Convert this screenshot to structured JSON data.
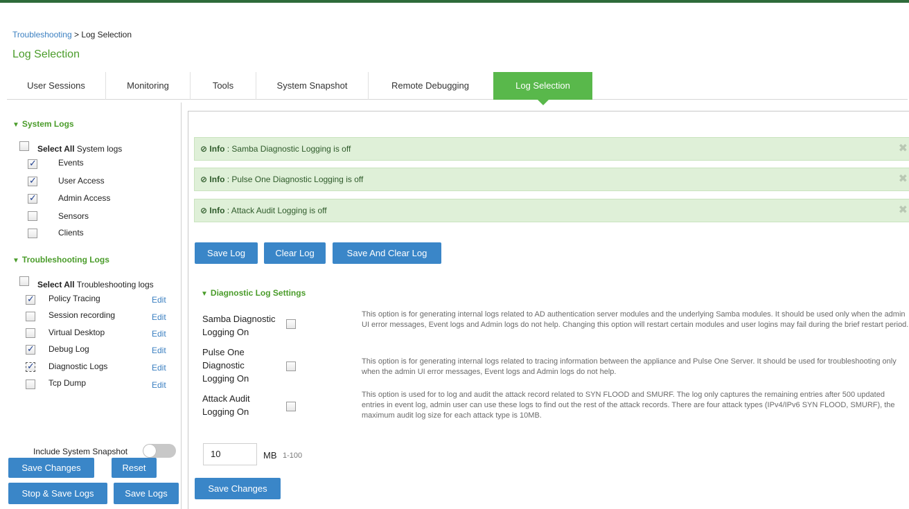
{
  "breadcrumb": {
    "link": "Troubleshooting",
    "separator": " > ",
    "current": "Log Selection"
  },
  "page_title": "Log Selection",
  "tabs": [
    {
      "label": "User Sessions"
    },
    {
      "label": "Monitoring"
    },
    {
      "label": "Tools"
    },
    {
      "label": "System Snapshot"
    },
    {
      "label": "Remote Debugging"
    },
    {
      "label": "Log Selection",
      "active": true
    }
  ],
  "system_logs": {
    "title": "System Logs",
    "select_all_bold": "Select All",
    "select_all_rest": " System logs",
    "items": [
      {
        "label": "Events",
        "checked": true
      },
      {
        "label": "User Access",
        "checked": true
      },
      {
        "label": "Admin Access",
        "checked": true
      },
      {
        "label": "Sensors",
        "checked": false
      },
      {
        "label": "Clients",
        "checked": false
      }
    ]
  },
  "troubleshooting_logs": {
    "title": "Troubleshooting Logs",
    "select_all_bold": "Select All",
    "select_all_rest": " Troubleshooting logs",
    "edit_label": "Edit",
    "items": [
      {
        "label": "Policy Tracing",
        "checked": true
      },
      {
        "label": "Session recording",
        "checked": false
      },
      {
        "label": "Virtual Desktop",
        "checked": false
      },
      {
        "label": "Debug Log",
        "checked": true
      },
      {
        "label": "Diagnostic Logs",
        "checked": true
      },
      {
        "label": "Tcp Dump",
        "checked": false
      }
    ]
  },
  "snapshot_toggle": {
    "label": "Include System Snapshot",
    "on": false
  },
  "left_buttons": {
    "save_changes": "Save Changes",
    "reset": "Reset",
    "stop_save_logs": "Stop & Save Logs",
    "save_logs": "Save Logs"
  },
  "info_messages": [
    {
      "prefix": "Info",
      "sep": " : ",
      "text": "Samba Diagnostic Logging is off"
    },
    {
      "prefix": "Info",
      "sep": " : ",
      "text": "Pulse One Diagnostic Logging is off"
    },
    {
      "prefix": "Info",
      "sep": " : ",
      "text": "Attack Audit Logging is off"
    }
  ],
  "log_buttons": {
    "save": "Save Log",
    "clear": "Clear Log",
    "save_and_clear": "Save And Clear Log"
  },
  "diagnostic": {
    "title": "Diagnostic Log Settings",
    "samba": {
      "label_1": "Samba Diagnostic",
      "label_2": "Logging On",
      "checked": false,
      "description": "This option is for generating internal logs related to AD authentication server modules and the underlying Samba modules. It should be used only when the admin UI error messages, Event logs and Admin logs do not help. Changing this option will restart certain modules and user logins may fail during the brief restart period."
    },
    "pulse_one": {
      "label_1": "Pulse One",
      "label_2": "Diagnostic",
      "label_3": "Logging On",
      "checked": false,
      "description": "This option is for generating internal logs related to tracing information between the appliance and Pulse One Server. It should be used for troubleshooting only when the admin UI error messages, Event logs and Admin logs do not help."
    },
    "attack_audit": {
      "label_1": "Attack Audit",
      "label_2": "Logging On",
      "checked": false,
      "description": "This option is used for to log and audit the attack record related to SYN FLOOD and SMURF. The log only captures the remaining entries after 500 updated entries in event log, admin user can use these logs to find out the rest of the attack records. There are four attack types (IPv4/IPv6 SYN FLOOD, SMURF), the maximum audit log size for each attack type is 10MB."
    },
    "size_value": "10",
    "size_unit": "MB",
    "size_range": "1-100"
  },
  "main_save_changes": "Save Changes",
  "colors": {
    "accent_green": "#59b84b",
    "title_green": "#4a9c2a",
    "button_blue": "#3a86c8",
    "info_bg": "#dff0d8"
  }
}
